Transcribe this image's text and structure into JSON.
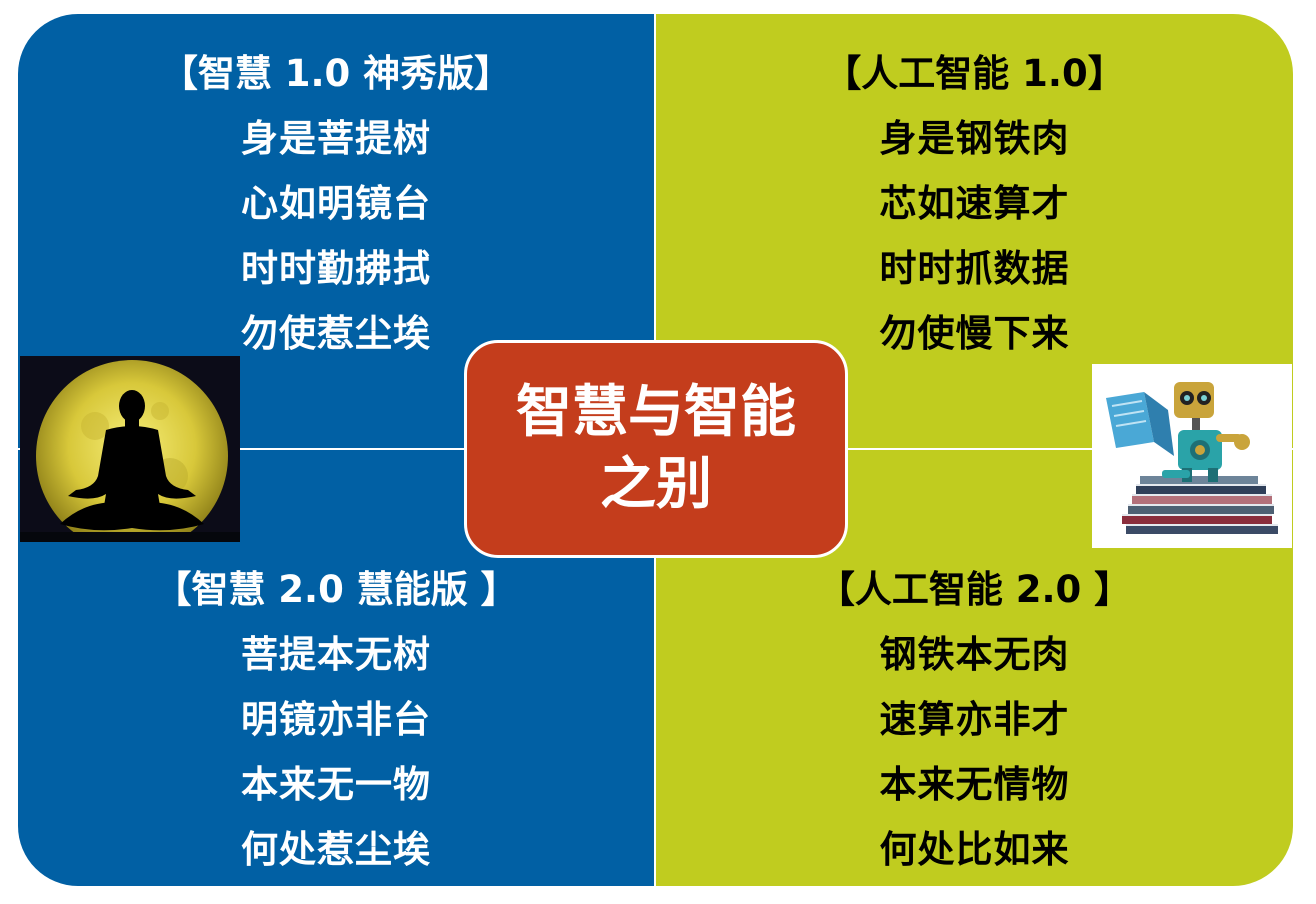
{
  "center": {
    "line1": "智慧与智能",
    "line2": "之别"
  },
  "quadrants": {
    "top_left": {
      "title": "【智慧 1.0 神秀版】",
      "lines": [
        "身是菩提树",
        "心如明镜台",
        "时时勤拂拭",
        "勿使惹尘埃"
      ]
    },
    "top_right": {
      "title": "【人工智能 1.0】",
      "lines": [
        "身是钢铁肉",
        "芯如速算才",
        "时时抓数据",
        "勿使慢下来"
      ]
    },
    "bottom_left": {
      "title": "【智慧 2.0 慧能版 】",
      "lines": [
        "菩提本无树",
        "明镜亦非台",
        "本来无一物",
        "何处惹尘埃"
      ]
    },
    "bottom_right": {
      "title": "【人工智能 2.0 】",
      "lines": [
        "钢铁本无肉",
        "速算亦非才",
        "本来无情物",
        "何处比如来"
      ]
    }
  },
  "colors": {
    "blue": "#0160a4",
    "green": "#c0cc1f",
    "center": "#c43d1c"
  },
  "images": [
    "meditation-silhouette-moon",
    "robot-reading-on-books"
  ]
}
